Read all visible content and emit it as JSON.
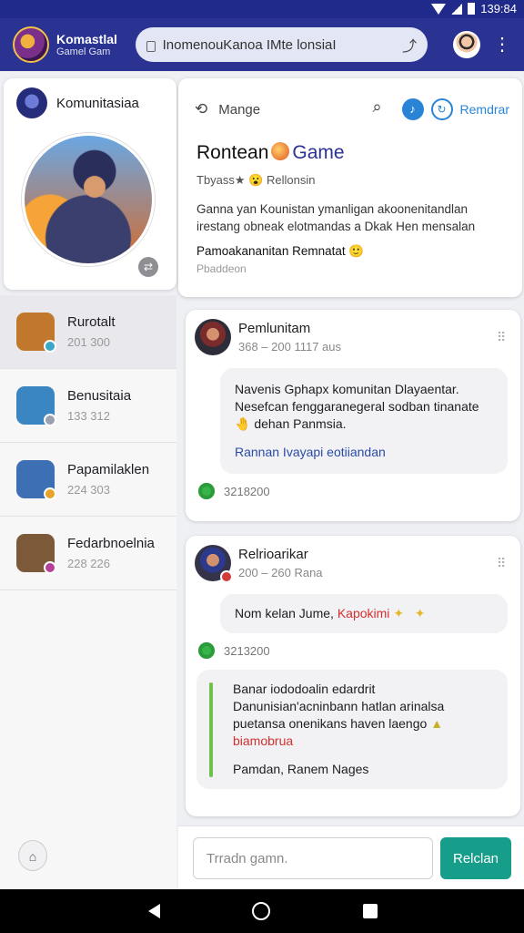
{
  "status": {
    "time": "139:84"
  },
  "appbar": {
    "title": "Komastlal",
    "subtitle": "Gamel Gam",
    "url": "InomenouKanoa IMte lonsiaI"
  },
  "left_profile": {
    "name": "Komunitasiaa"
  },
  "left_list": [
    {
      "name": "Rurotalt",
      "count": "201 300",
      "color": "#c1782c",
      "badge": "#3aa7c8"
    },
    {
      "name": "Benusitaia",
      "count": "133 312",
      "color": "#3a86c2",
      "badge": "#9aa0ad"
    },
    {
      "name": "Papamilaklen",
      "count": "224 303",
      "color": "#3d6fb5",
      "badge": "#e6a42b"
    },
    {
      "name": "Fedarbnoelnia",
      "count": "228 226",
      "color": "#7c5a39",
      "badge": "#b5409a"
    }
  ],
  "topcard": {
    "manage": "Mange",
    "link": "Remdrar",
    "title_a": "Rontean",
    "title_b": "Game",
    "meta": "Tbyass★ 😮 Rellonsin",
    "desc": "Ganna yan Kounistan ymanligan akoonenitandlan irestang obneak elotmandas a Dkak Hen mensalan",
    "foot": "Pamoakananitan Remnatat 🙂",
    "small": "Pbaddeon"
  },
  "posts": [
    {
      "name": "Pemlunitam",
      "time": "368 – 200 1117 aus",
      "text": "Navenis Gphapx komunitan Dlayaentar. Nesefcan fenggaranegeral sodban tinanate🤚 dehan Panmsia.",
      "link": "Rannan Ivayapi eotiiandan",
      "reactions": "3218200"
    },
    {
      "name": "Relrioarikar",
      "time": "200 – 260 Rana",
      "text_plain": "Nom kelan Jume, ",
      "text_red": "Kapokimi",
      "reactions": "3213200",
      "text2": "Banar iododoalin edardrit Danunisian'acninbann hatlan arinalsa puetansa onenikans haven laengo",
      "text2_red": "biamobrua",
      "text2_foot": "Pamdan, Ranem Nages"
    }
  ],
  "composer": {
    "placeholder": "Trradn gamn.",
    "button": "Relclan"
  },
  "colors": {
    "appbar": "#2a3292",
    "accent": "#2a84d6",
    "send": "#179e8a"
  }
}
